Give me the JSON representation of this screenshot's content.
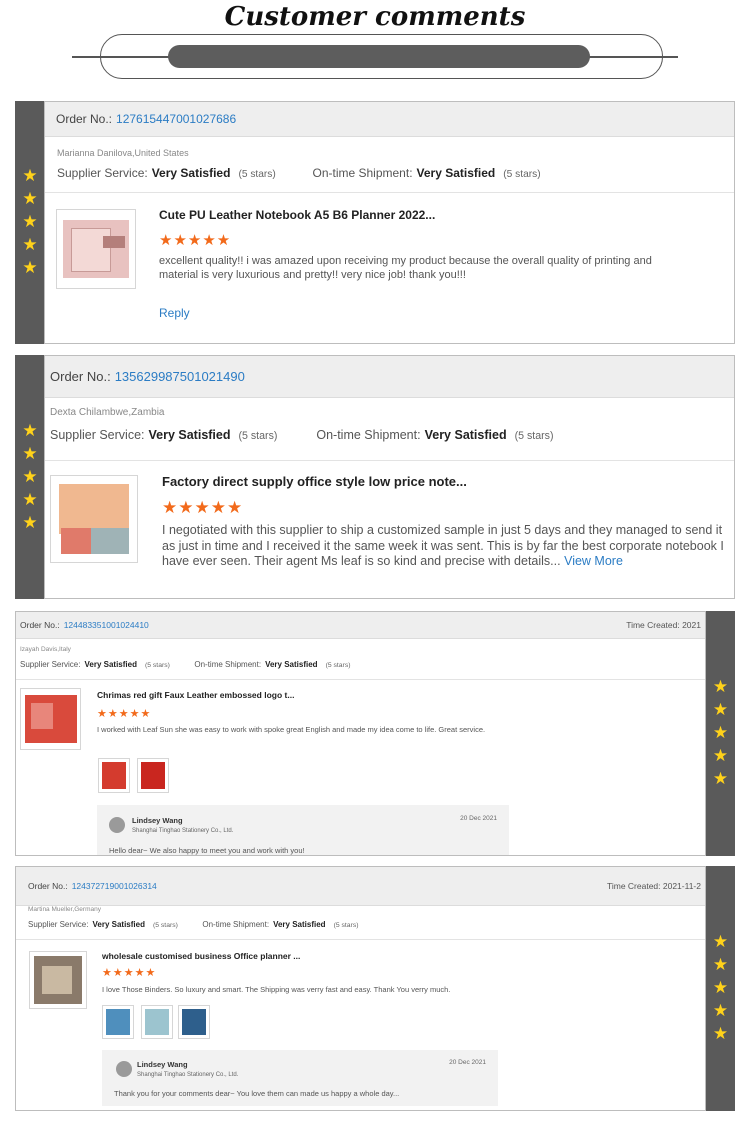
{
  "page": {
    "title": "Customer comments"
  },
  "colors": {
    "accent_link": "#2b7cc4",
    "rating_star": "#f26a1b",
    "strip_star": "#ffd21a",
    "strip_bg": "#5a5a5a"
  },
  "icons": {
    "strip_star": "★",
    "rating_star": "★"
  },
  "labels": {
    "order_no": "Order No.:",
    "supplier_service": "Supplier Service:",
    "ontime_shipment": "On-time Shipment:",
    "reply": "Reply",
    "time_created": "Time Created:"
  },
  "reviews": [
    {
      "order_no": "127615447001027686",
      "customer": "Marianna Danilova,United States",
      "supplier_rating": "Very Satisfied",
      "supplier_stars": "(5 stars)",
      "shipment_rating": "Very Satisfied",
      "shipment_stars": "(5 stars)",
      "product_title": "Cute PU Leather Notebook A5 B6 Planner 2022...",
      "stars": "★★★★★",
      "text": "excellent quality!! i was amazed upon receiving my product because the overall quality of printing and material is very luxurious and pretty!! very nice job! thank you!!!",
      "reply_label": "Reply"
    },
    {
      "order_no": "135629987501021490",
      "customer": "Dexta Chilambwe,Zambia",
      "supplier_rating": "Very Satisfied",
      "supplier_stars": "(5 stars)",
      "shipment_rating": "Very Satisfied",
      "shipment_stars": "(5 stars)",
      "product_title": "Factory direct supply office style low price note...",
      "stars": "★★★★★",
      "text": "I negotiated with this supplier to ship a customized sample in just 5 days and they managed to send it as just in time and I received it the same week it was sent. This is by far the best corporate notebook I have ever seen. Their agent Ms leaf is so kind and precise with details...",
      "more_label": "View More"
    },
    {
      "order_no": "124483351001024410",
      "time_created": "Time Created: 2021",
      "customer": "Izayah Davis,Italy",
      "supplier_rating": "Very Satisfied",
      "supplier_stars": "(5 stars)",
      "shipment_rating": "Very Satisfied",
      "shipment_stars": "(5 stars)",
      "product_title": "Chrimas red gift Faux Leather embossed logo t...",
      "stars": "★★★★★",
      "text": "I worked with Leaf Sun she was easy to work with spoke great English and made my idea come to life. Great service.",
      "reply": {
        "name": "Lindsey Wang",
        "company": "Shanghai Tinghao Stationery Co., Ltd.",
        "date": "20 Dec 2021",
        "text": "Hello dear~ We also happy to meet you and work with you!"
      }
    },
    {
      "order_no": "124372719001026314",
      "time_created": "Time Created: 2021-11-2",
      "customer": "Martina Mueller,Germany",
      "supplier_rating": "Very Satisfied",
      "supplier_stars": "(5 stars)",
      "shipment_rating": "Very Satisfied",
      "shipment_stars": "(5 stars)",
      "product_title": "wholesale customised business Office planner ...",
      "stars": "★★★★★",
      "text": "I love Those Binders. So luxury and smart. The Shipping was verry fast and easy. Thank You verry much.",
      "reply": {
        "name": "Lindsey Wang",
        "company": "Shanghai Tinghao Stationery Co., Ltd.",
        "date": "20 Dec 2021",
        "text": "Thank you for your comments dear~ You love them can made us happy a whole day..."
      }
    }
  ]
}
